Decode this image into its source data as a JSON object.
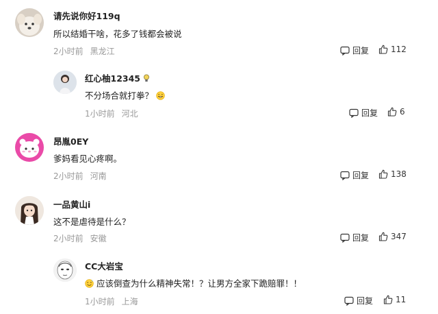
{
  "comments": [
    {
      "username": "请先说你好119q",
      "text": "所以结婚干啥，花多了钱都会被说",
      "time": "2小时前",
      "location": "黑龙江",
      "reply_label": "回复",
      "likes": "112",
      "avatar_icon": "dog-avatar"
    },
    {
      "username": "红心柚12345",
      "text": "不分场合就打拳？",
      "time": "1小时前",
      "location": "河北",
      "reply_label": "回复",
      "likes": "6",
      "avatar_icon": "girl-photo-avatar",
      "badge_icon": "bulb-icon",
      "trailing_emoji": "grin-emoji"
    },
    {
      "username": "昂胤0EY",
      "text": "爹妈看见心疼啊。",
      "time": "2小时前",
      "location": "河南",
      "reply_label": "回复",
      "likes": "138",
      "avatar_icon": "pink-cat-avatar"
    },
    {
      "username": "一品黄山i",
      "text": "这不是虐待是什么？",
      "time": "2小时前",
      "location": "安徽",
      "reply_label": "回复",
      "likes": "347",
      "avatar_icon": "anime-girl-avatar"
    },
    {
      "username": "CC大岩宝",
      "text": "应该倒查为什么精神失常！？让男方全家下跪赔罪！！",
      "time": "1小时前",
      "location": "上海",
      "reply_label": "回复",
      "likes": "11",
      "avatar_icon": "sketch-face-avatar",
      "leading_emoji": "sweat-smile-emoji"
    }
  ],
  "colors": {
    "text": "#222222",
    "meta": "#999999",
    "icon": "#333333"
  }
}
